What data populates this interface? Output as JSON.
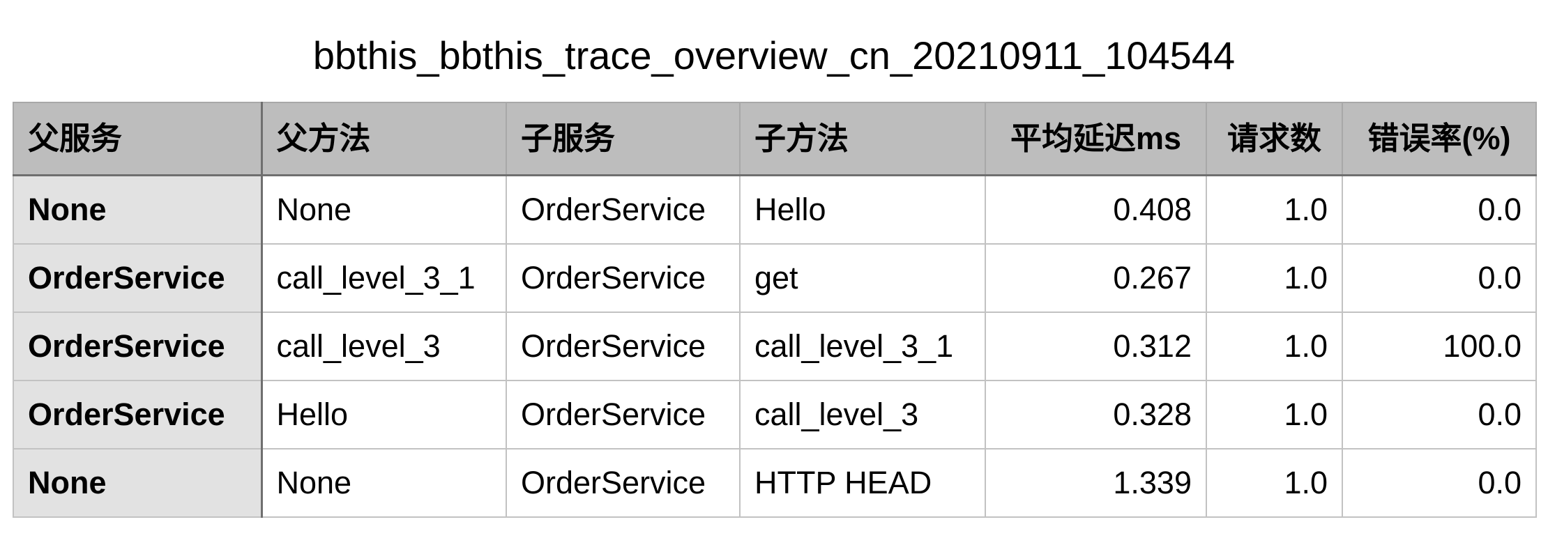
{
  "title": "bbthis_bbthis_trace_overview_cn_20210911_104544",
  "table": {
    "headers": [
      "父服务",
      "父方法",
      "子服务",
      "子方法",
      "平均延迟ms",
      "请求数",
      "错误率(%)"
    ],
    "rows": [
      [
        "None",
        "None",
        "OrderService",
        "Hello",
        "0.408",
        "1.0",
        "0.0"
      ],
      [
        "OrderService",
        "call_level_3_1",
        "OrderService",
        "get",
        "0.267",
        "1.0",
        "0.0"
      ],
      [
        "OrderService",
        "call_level_3",
        "OrderService",
        "call_level_3_1",
        "0.312",
        "1.0",
        "100.0"
      ],
      [
        "OrderService",
        "Hello",
        "OrderService",
        "call_level_3",
        "0.328",
        "1.0",
        "0.0"
      ],
      [
        "None",
        "None",
        "OrderService",
        "HTTP HEAD",
        "1.339",
        "1.0",
        "0.0"
      ]
    ]
  }
}
